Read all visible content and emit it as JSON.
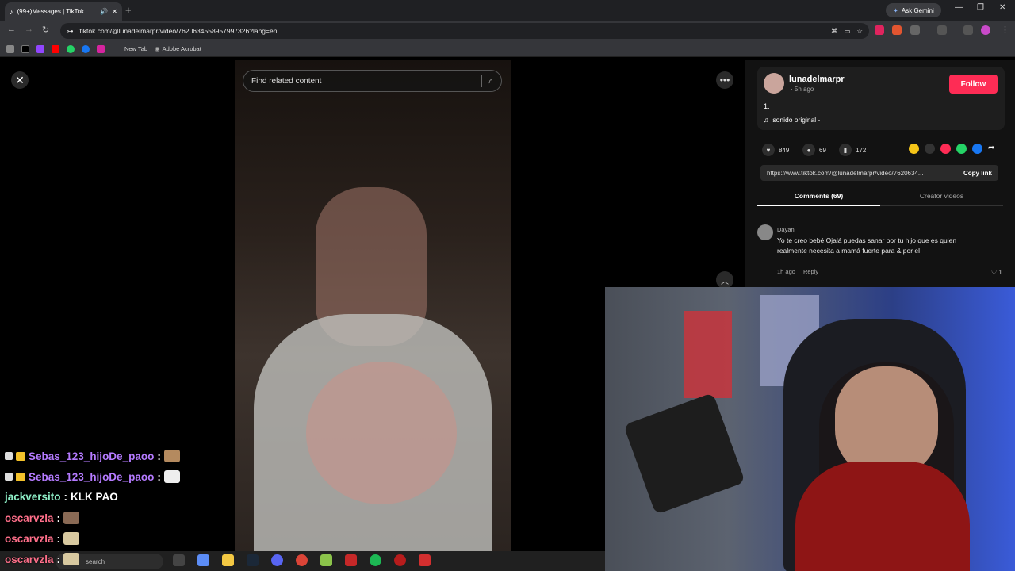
{
  "browser": {
    "tab_title": "(99+)Messages | TikTok",
    "new_tab_symbol": "+",
    "ask_gemini": "Ask Gemini",
    "url": "tiktok.com/@lunadelmarpr/video/7620634558957997326?lang=en",
    "bookmarks": [
      "New Tab",
      "Adobe Acrobat"
    ]
  },
  "search": {
    "placeholder": "Find related content"
  },
  "post": {
    "username": "lunadelmarpr",
    "time_ago": "· 5h ago",
    "follow_label": "Follow",
    "description": "1.",
    "music": "sonido original -",
    "likes": "849",
    "comments": "69",
    "saves": "172",
    "share_url": "https://www.tiktok.com/@lunadelmarpr/video/7620634...",
    "copy_link_label": "Copy link"
  },
  "tabs": {
    "comments": "Comments (69)",
    "creator_videos": "Creator videos"
  },
  "comment": {
    "author": "Dayan",
    "text": "Yo te creo bebé,Ojalá puedas sanar por tu hijo que es quien realmente necesita a mamá fuerte para & por el",
    "time": "1h ago",
    "reply_label": "Reply",
    "likes": "1"
  },
  "chat": [
    {
      "user": "Sebas_123_hijoDe_paoo",
      "sep": ":",
      "msg": "",
      "color": "#b57bff"
    },
    {
      "user": "Sebas_123_hijoDe_paoo",
      "sep": ":",
      "msg": "",
      "color": "#b57bff"
    },
    {
      "user": "jackversito",
      "sep": ":",
      "msg": "KLK PAO",
      "color": "#8ff0c8"
    },
    {
      "user": "oscarvzla",
      "sep": ":",
      "msg": "",
      "color": "#ff6f8a"
    },
    {
      "user": "oscarvzla",
      "sep": ":",
      "msg": "",
      "color": "#ff6f8a"
    },
    {
      "user": "oscarvzla",
      "sep": ":",
      "msg": "",
      "color": "#ff6f8a"
    }
  ],
  "taskbar": {
    "search_label": "search"
  },
  "colors": {
    "follow": "#fe2c55",
    "chrome_bg": "#35363a"
  }
}
